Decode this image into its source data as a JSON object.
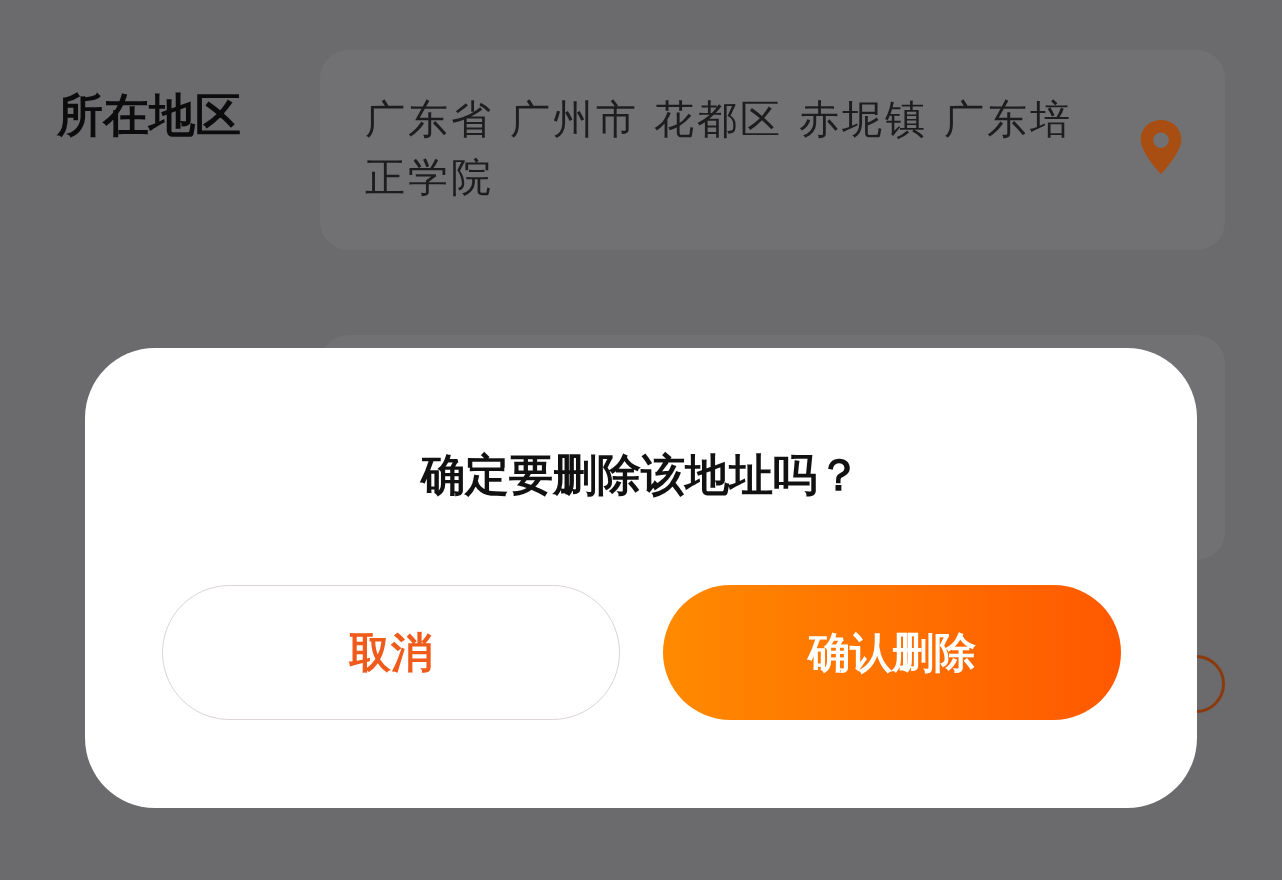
{
  "form": {
    "fields": [
      {
        "label": "所在地区",
        "kind": "location",
        "value": "广东省 广州市 花都区 赤坭镇 广东培正学院"
      },
      {
        "kind": "text"
      },
      {
        "kind": "toggle"
      }
    ]
  },
  "dialog": {
    "title": "确定要删除该地址吗？",
    "buttons": [
      {
        "label": "取消",
        "kind": "secondary"
      },
      {
        "label": "确认删除",
        "kind": "primary"
      }
    ]
  }
}
